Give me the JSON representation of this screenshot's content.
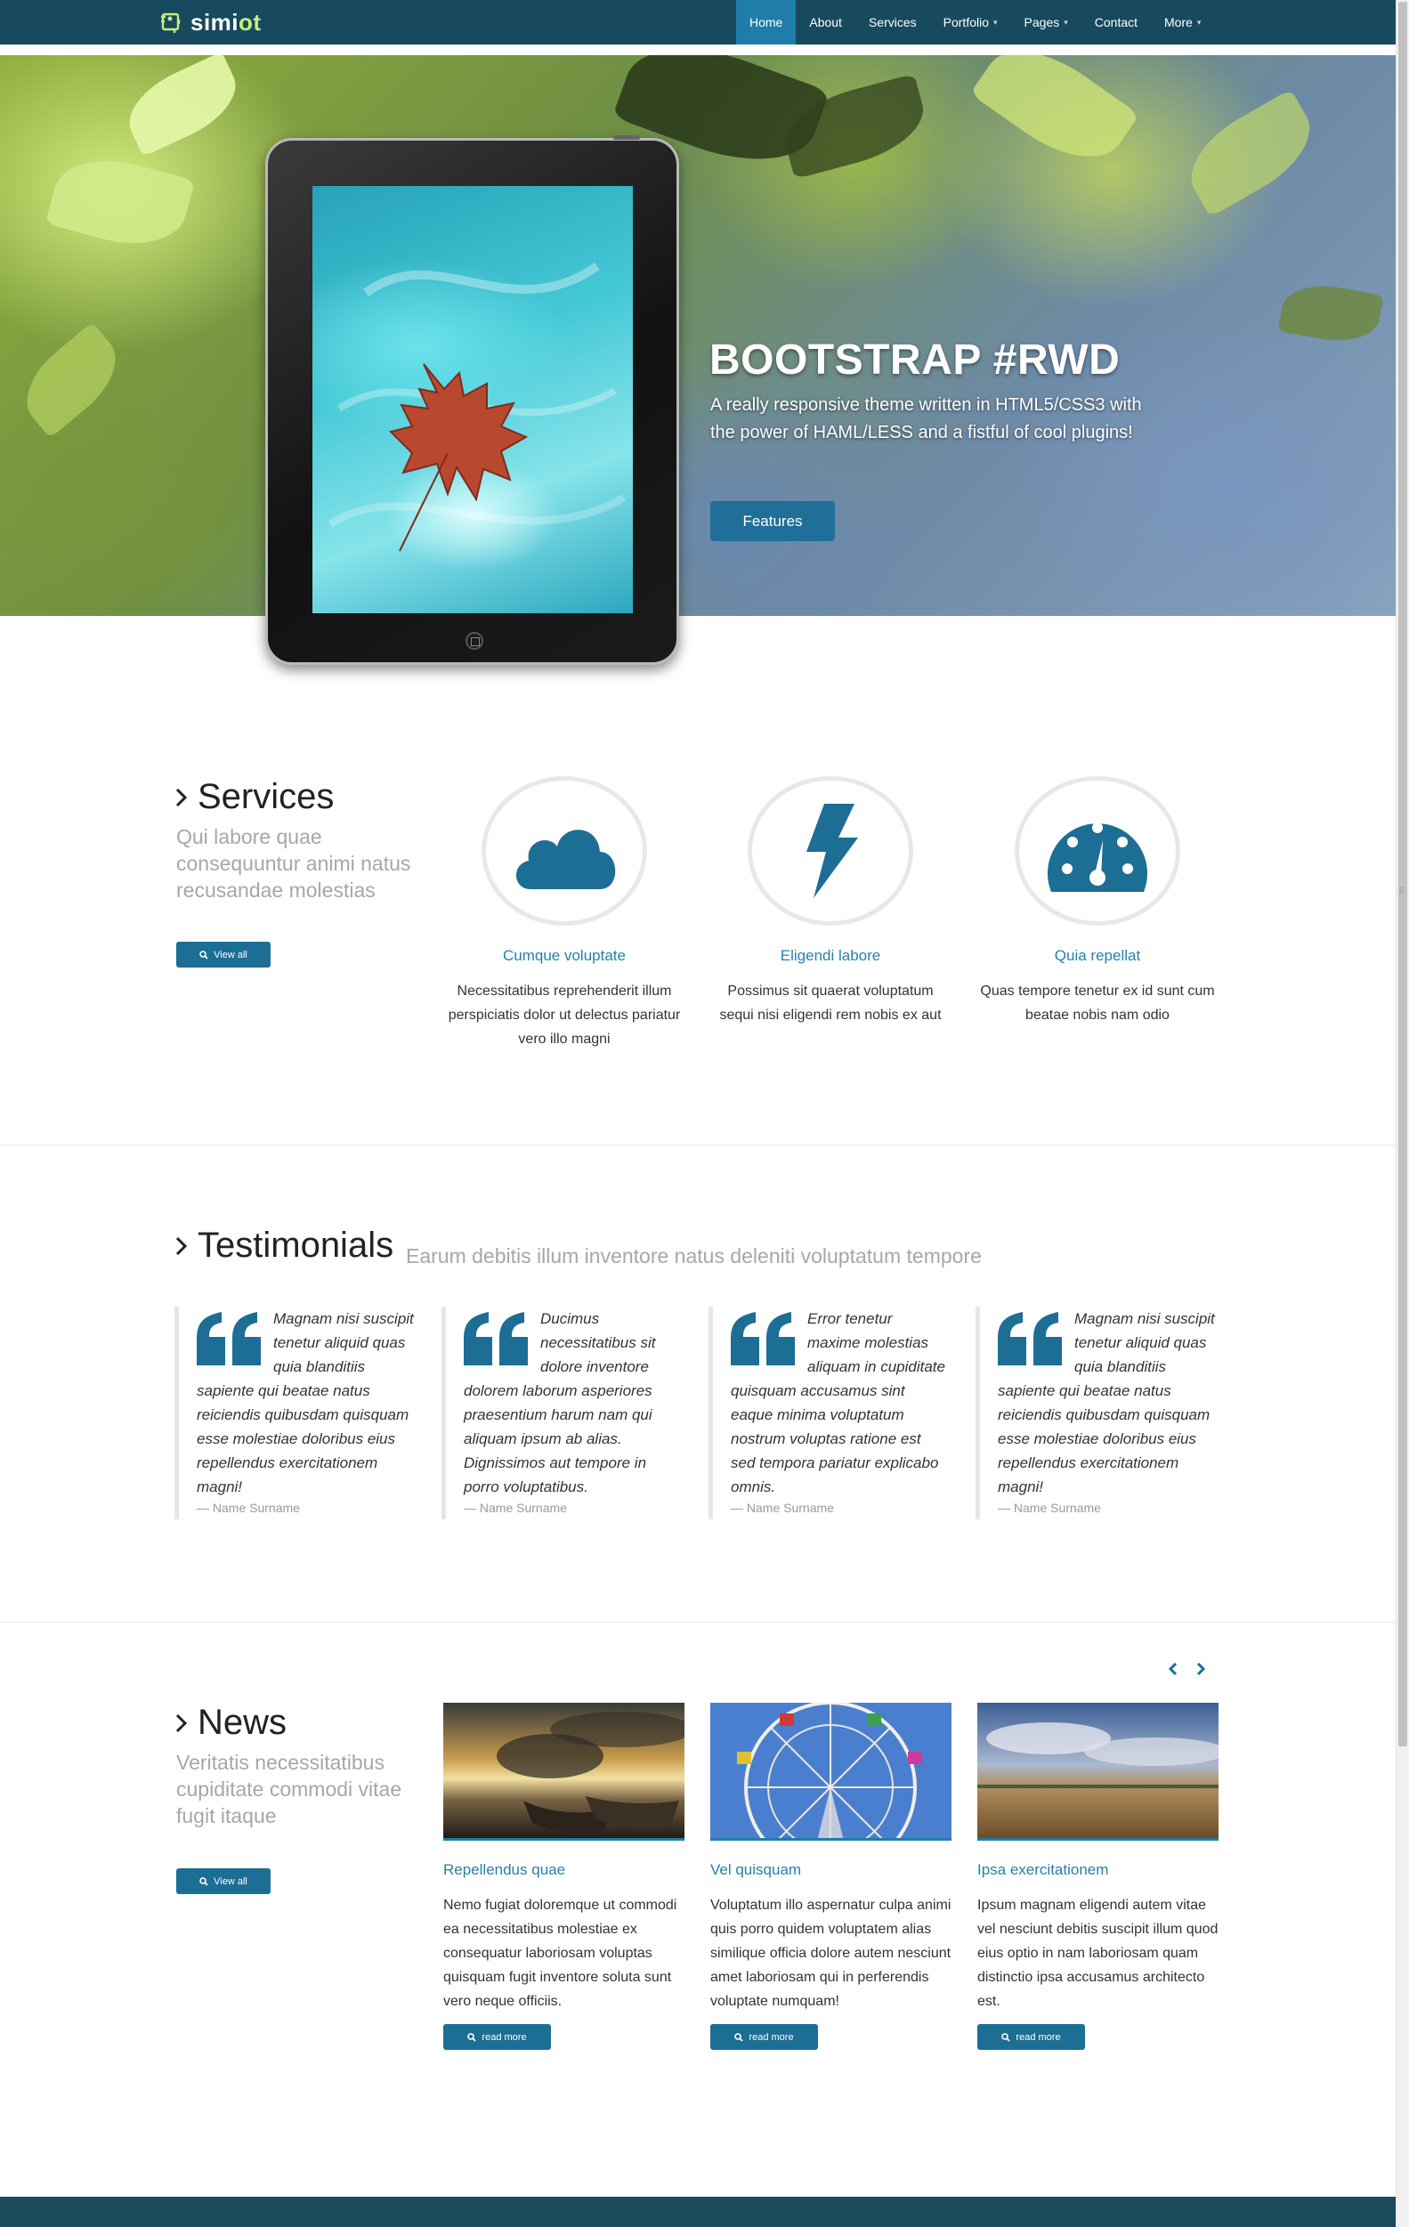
{
  "brand": {
    "prefix": "simi",
    "suffix": "ot"
  },
  "nav": {
    "items": [
      {
        "label": "Home",
        "active": true,
        "dropdown": false
      },
      {
        "label": "About",
        "active": false,
        "dropdown": false
      },
      {
        "label": "Services",
        "active": false,
        "dropdown": false
      },
      {
        "label": "Portfolio",
        "active": false,
        "dropdown": true
      },
      {
        "label": "Pages",
        "active": false,
        "dropdown": true
      },
      {
        "label": "Contact",
        "active": false,
        "dropdown": false
      },
      {
        "label": "More",
        "active": false,
        "dropdown": true
      }
    ],
    "caret": "⌄"
  },
  "hero": {
    "title": "BOOTSTRAP #RWD",
    "subtitle": "A really responsive theme written in HTML5/CSS3 with the power of HAML/LESS and a fistful of cool plugins!",
    "button": "Features"
  },
  "services": {
    "title": "Services",
    "subtitle": "Qui labore quae consequuntur animi natus recusandae molestias",
    "view_all": "View all",
    "items": [
      {
        "icon": "cloud-icon",
        "name": "Cumque voluptate",
        "desc": "Necessitatibus reprehenderit illum perspiciatis dolor ut delectus pariatur vero illo magni"
      },
      {
        "icon": "bolt-icon",
        "name": "Eligendi labore",
        "desc": "Possimus sit quaerat voluptatum sequi nisi eligendi rem nobis ex aut"
      },
      {
        "icon": "dashboard-icon",
        "name": "Quia repellat",
        "desc": "Quas tempore tenetur ex id sunt cum beatae nobis nam odio"
      }
    ]
  },
  "testimonials": {
    "title": "Testimonials",
    "subtitle": "Earum debitis illum inventore natus deleniti voluptatum tempore",
    "items": [
      {
        "text": "Magnam nisi suscipit tenetur aliquid quas quia blanditiis sapiente qui beatae natus reiciendis quibusdam quisquam esse molestiae doloribus eius repellendus exercitationem magni!",
        "author": "— Name Surname"
      },
      {
        "text": "Ducimus necessitatibus sit dolore inventore dolorem laborum asperiores praesentium harum nam qui aliquam ipsum ab alias. Dignissimos aut tempore in porro voluptatibus.",
        "author": "— Name Surname"
      },
      {
        "text": "Error tenetur maxime molestias aliquam in cupiditate quisquam accusamus sint eaque minima voluptatum nostrum voluptas ratione est sed tempora pariatur explicabo omnis.",
        "author": "— Name Surname"
      },
      {
        "text": "Magnam nisi suscipit tenetur aliquid quas quia blanditiis sapiente qui beatae natus reiciendis quibusdam quisquam esse molestiae doloribus eius repellendus exercitationem magni!",
        "author": "— Name Surname"
      }
    ]
  },
  "news": {
    "title": "News",
    "subtitle": "Veritatis necessitatibus cupiditate commodi vitae fugit itaque",
    "view_all": "View all",
    "items": [
      {
        "title": "Repellendus quae",
        "text": "Nemo fugiat doloremque ut commodi ea necessitatibus molestiae ex consequatur laboriosam voluptas quisquam fugit inventore soluta sunt vero neque officiis.",
        "button": "read more"
      },
      {
        "title": "Vel quisquam",
        "text": "Voluptatum illo aspernatur culpa animi quis porro quidem voluptatem alias similique officia dolore autem nesciunt amet laboriosam qui in perferendis voluptate numquam!",
        "button": "read more"
      },
      {
        "title": "Ipsa exercitationem",
        "text": "Ipsum magnam eligendi autem vitae vel nesciunt debitis suscipit illum quod eius optio in nam laboriosam quam distinctio ipsa accusamus architecto est.",
        "button": "read more"
      }
    ]
  },
  "colors": {
    "navbar": "#174a5e",
    "accent": "#1f7ea9",
    "button": "#1d6e94",
    "brand_highlight": "#c9ed7b"
  }
}
